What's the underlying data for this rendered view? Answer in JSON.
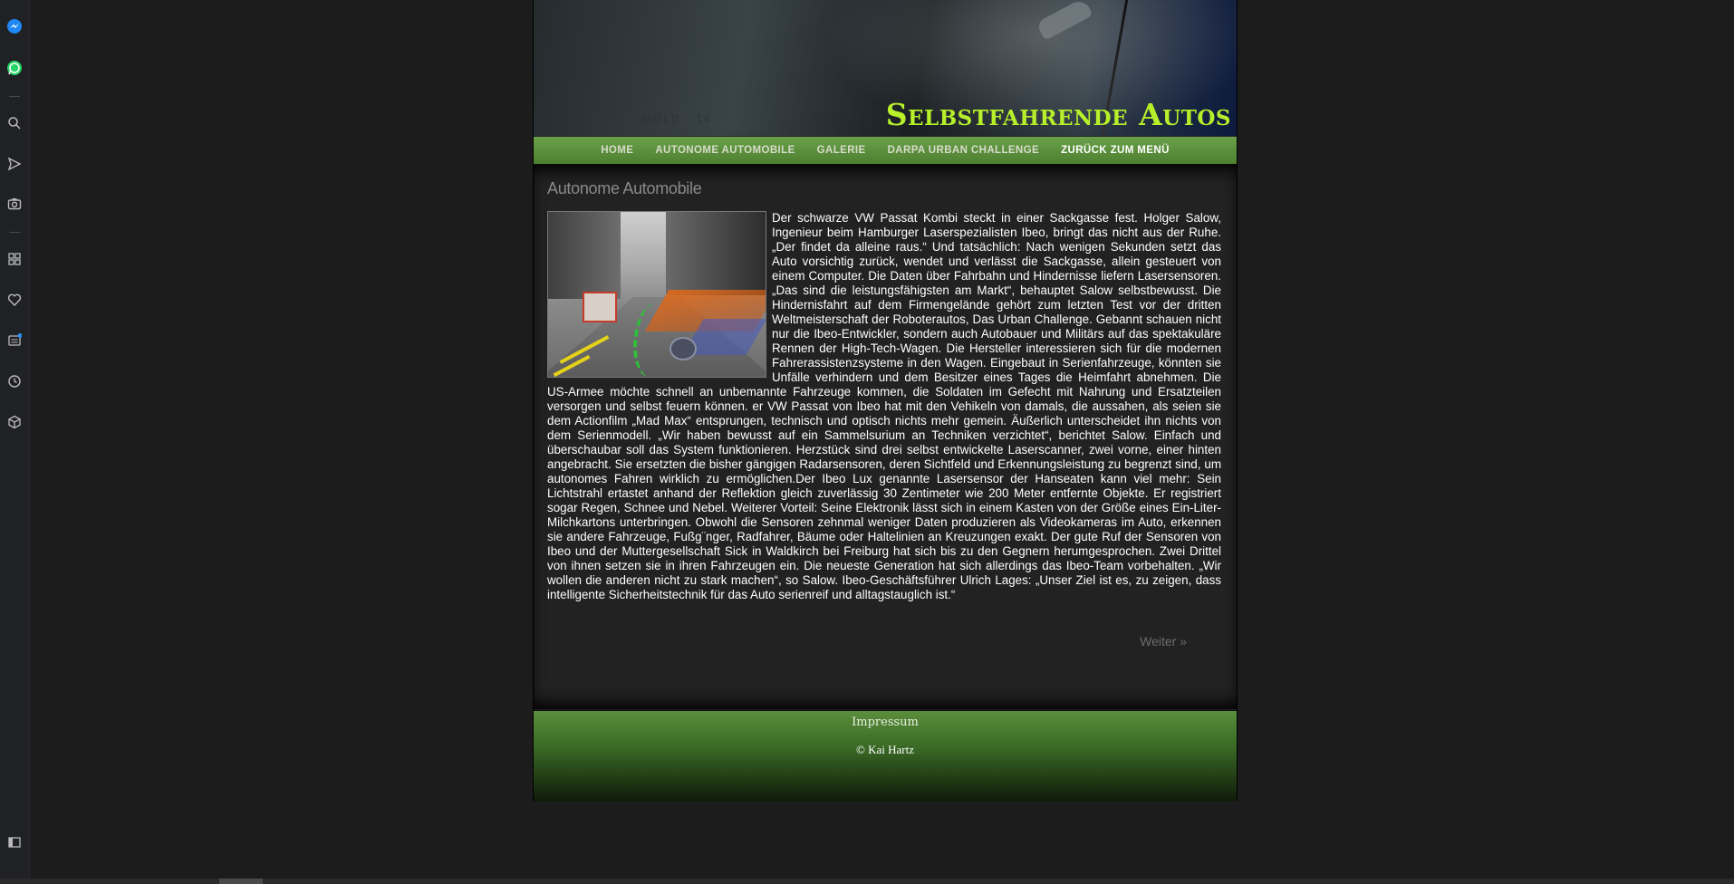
{
  "browser_sidebar": {
    "icons": [
      "messenger-icon",
      "whatsapp-icon",
      "search-icon",
      "send-icon",
      "camera-icon",
      "apps-icon",
      "heart-icon",
      "news-icon",
      "history-icon",
      "cube-icon",
      "sidebar-toggle-icon"
    ]
  },
  "header": {
    "site_title": "Selbstfahrende Autos",
    "plate_text": "MOLD · 16"
  },
  "nav": {
    "items": [
      {
        "label": "Home"
      },
      {
        "label": "Autonome Automobile"
      },
      {
        "label": "Galerie"
      },
      {
        "label": "Darpa Urban Challenge"
      },
      {
        "label": "Zurück zum Menü"
      }
    ]
  },
  "content": {
    "heading": "Autonome Automobile",
    "article_text": "Der schwarze VW Passat Kombi steckt in einer Sackgasse fest. Holger Salow, Ingenieur beim Hamburger Laserspezialisten Ibeo, bringt das nicht aus der Ruhe. „Der findet da alleine raus.“ Und tatsächlich: Nach wenigen Sekunden setzt das Auto vorsichtig zurück, wendet und verlässt die Sackgasse, allein gesteuert von einem Computer. Die Daten über Fahrbahn und Hindernisse liefern Lasersensoren. „Das sind die leistungsfähigsten am Markt“, behauptet Salow selbstbewusst. Die Hindernisfahrt auf dem Firmengelände gehört zum letzten Test vor der dritten Weltmeisterschaft der Roboterautos, Das Urban Challenge. Gebannt schauen nicht nur die Ibeo-Entwickler, sondern auch Autobauer und Militärs auf das spektakuläre Rennen der High-Tech-Wagen. Die Hersteller interessieren sich für die modernen Fahrerassistenzsysteme in den Wagen. Eingebaut in Serienfahrzeuge, könnten sie Unfälle verhindern und dem Besitzer eines Tages die Heimfahrt abnehmen. Die US-Armee möchte schnell an unbemannte Fahrzeuge kommen, die Soldaten im Gefecht mit Nahrung und Ersatzteilen versorgen und selbst feuern können. er VW Passat von Ibeo hat mit den Vehikeln von damals, die aussahen, als seien sie dem Actionfilm „Mad Max“ entsprungen, technisch und optisch nichts mehr gemein. Äußerlich unterscheidet ihn nichts von dem Serienmodell. „Wir haben bewusst auf ein Sammelsurium an Techniken verzichtet“, berichtet Salow. Einfach und überschaubar soll das System funktionieren. Herzstück sind drei selbst entwickelte Laserscanner, zwei vorne, einer hinten angebracht. Sie ersetzten die bisher gängigen Radarsensoren, deren Sichtfeld und Erkennungsleistung zu begrenzt sind, um autonomes Fahren wirklich zu ermöglichen.Der Ibeo Lux genannte Lasersensor der Hanseaten kann viel mehr: Sein Lichtstrahl ertastet anhand der Reflektion gleich zuverlässig 30 Zentimeter wie 200 Meter entfernte Objekte. Er registriert sogar Regen, Schnee und Nebel. Weiterer Vorteil: Seine Elektronik lässt sich in einem Kasten von der Größe eines Ein-Liter-Milchkartons unterbringen. Obwohl die Sensoren zehnmal weniger Daten produzieren als Videokameras im Auto, erkennen sie andere Fahrzeuge, Fußg¨nger, Radfahrer, Bäume oder Haltelinien an Kreuzungen exakt. Der gute Ruf der Sensoren von Ibeo und der Muttergesellschaft Sick in Waldkirch bei Freiburg hat sich bis zu den Gegnern herumgesprochen. Zwei Drittel von ihnen setzen sie in ihren Fahrzeugen ein. Die neueste Generation hat sich allerdings das Ibeo-Team vorbehalten. „Wir wollen die anderen nicht zu stark machen“, so Salow. Ibeo-Geschäftsführer Ulrich Lages: „Unser Ziel ist es, zu zeigen, dass intelligente Sicherheitstechnik für das Auto serienreif und alltagstauglich ist.“",
    "more_link": "Weiter »"
  },
  "footer": {
    "impressum": "Impressum",
    "copyright": "© Kai Hartz"
  },
  "colors": {
    "title": "#b7f02a",
    "nav_green": "#5b9140",
    "background": "#1c1c1c"
  }
}
